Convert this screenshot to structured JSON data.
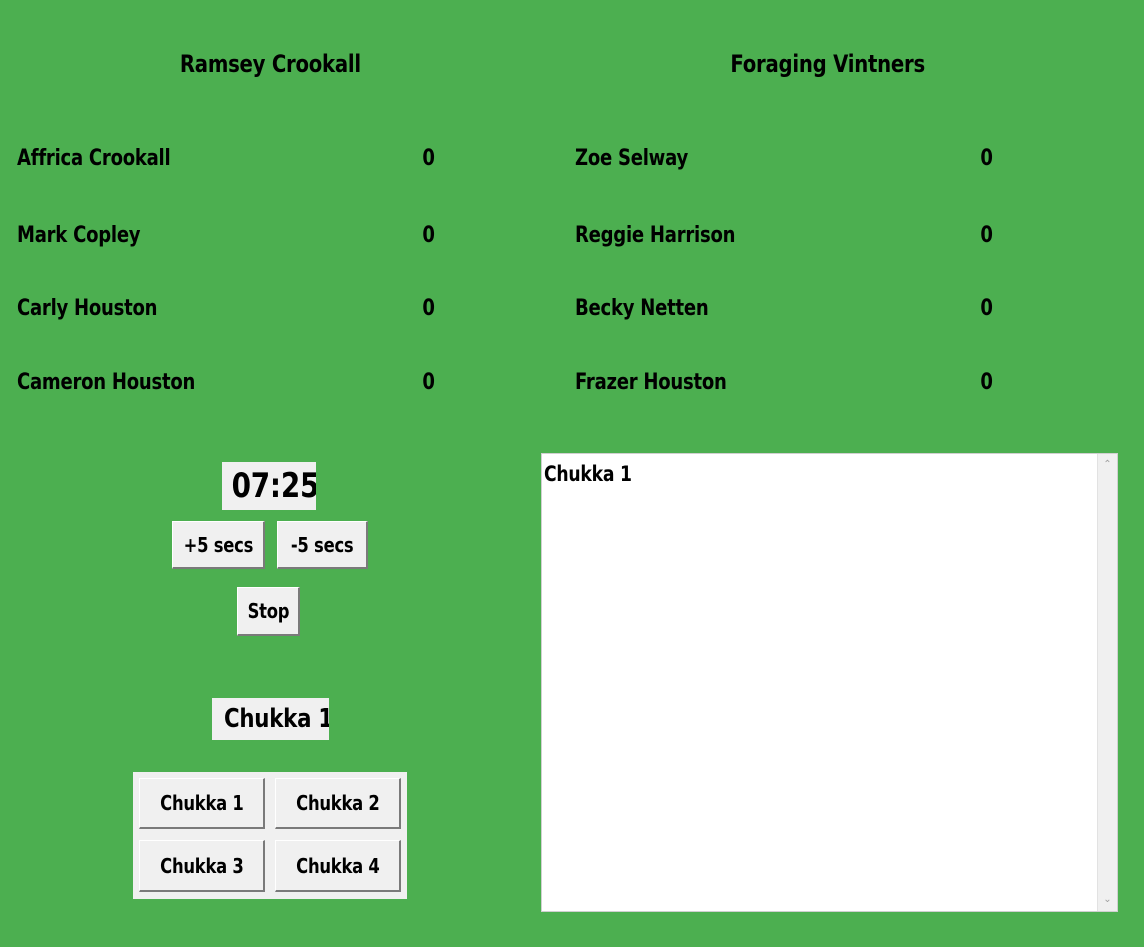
{
  "teams": [
    {
      "name": "Ramsey Crookall",
      "players": [
        {
          "name": "Affrica Crookall",
          "score": "0"
        },
        {
          "name": "Mark Copley",
          "score": "0"
        },
        {
          "name": "Carly Houston",
          "score": "0"
        },
        {
          "name": "Cameron Houston",
          "score": "0"
        }
      ]
    },
    {
      "name": "Foraging Vintners",
      "players": [
        {
          "name": "Zoe Selway",
          "score": "0"
        },
        {
          "name": "Reggie Harrison",
          "score": "0"
        },
        {
          "name": "Becky Netten",
          "score": "0"
        },
        {
          "name": "Frazer Houston",
          "score": "0"
        }
      ]
    }
  ],
  "timer": {
    "display": "07:25",
    "plus_label": "+5 secs",
    "minus_label": "-5 secs",
    "stop_label": "Stop"
  },
  "current_chukka": "Chukka 1",
  "chukka_buttons": [
    "Chukka 1",
    "Chukka 2",
    "Chukka 3",
    "Chukka 4"
  ],
  "log": {
    "text": "Chukka 1"
  },
  "icons": {
    "scroll_up": "chevron-up-icon",
    "scroll_down": "chevron-down-icon"
  },
  "colors": {
    "background": "#4caf50",
    "panel": "#f0f0f0"
  }
}
